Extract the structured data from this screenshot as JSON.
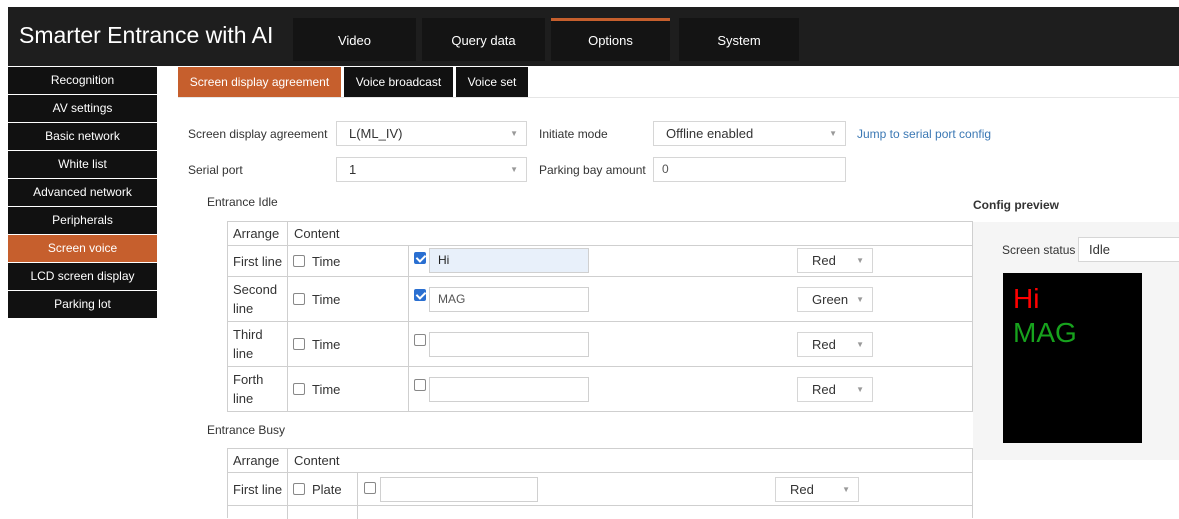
{
  "app": {
    "title": "Smarter Entrance with AI"
  },
  "top_tabs": [
    {
      "label": "Video"
    },
    {
      "label": "Query data"
    },
    {
      "label": "Options"
    },
    {
      "label": "System"
    }
  ],
  "sidebar": {
    "items": [
      {
        "label": "Recognition"
      },
      {
        "label": "AV settings"
      },
      {
        "label": "Basic network"
      },
      {
        "label": "White list"
      },
      {
        "label": "Advanced network"
      },
      {
        "label": "Peripherals"
      },
      {
        "label": "Screen voice"
      },
      {
        "label": "LCD screen display"
      },
      {
        "label": "Parking lot"
      }
    ],
    "active": "Screen voice"
  },
  "sub_tabs": [
    {
      "label": "Screen display agreement"
    },
    {
      "label": "Voice broadcast"
    },
    {
      "label": "Voice set"
    }
  ],
  "form": {
    "agreement_label": "Screen display agreement",
    "agreement_value": "L(ML_IV)",
    "initiate_label": "Initiate mode",
    "initiate_value": "Offline enabled",
    "jump_link": "Jump to serial port config",
    "serial_label": "Serial port",
    "serial_value": "1",
    "parking_label": "Parking bay amount",
    "parking_value": "0"
  },
  "entrance_idle": {
    "title": "Entrance Idle",
    "headers": {
      "arrange": "Arrange",
      "content": "Content"
    },
    "time_label": "Time",
    "rows": [
      {
        "name": "First line",
        "time_checked": false,
        "text_checked": true,
        "text": "Hi",
        "color": "Red"
      },
      {
        "name_a": "Second",
        "name_b": "line",
        "time_checked": false,
        "text_checked": true,
        "text": "MAG",
        "color": "Green"
      },
      {
        "name_a": "Third",
        "name_b": "line",
        "time_checked": false,
        "text_checked": false,
        "text": "",
        "color": "Red"
      },
      {
        "name_a": "Forth",
        "name_b": "line",
        "time_checked": false,
        "text_checked": false,
        "text": "",
        "color": "Red"
      }
    ]
  },
  "entrance_busy": {
    "title": "Entrance Busy",
    "headers": {
      "arrange": "Arrange",
      "content": "Content"
    },
    "plate_label": "Plate",
    "rows": [
      {
        "name": "First line",
        "plate_checked": false,
        "text_checked": false,
        "text": "",
        "color": "Red"
      }
    ]
  },
  "preview": {
    "title": "Config preview",
    "status_label": "Screen status",
    "status_value": "Idle",
    "lines": [
      {
        "text": "Hi",
        "color": "#ff0000"
      },
      {
        "text": "MAG",
        "color": "#17a21d"
      }
    ]
  },
  "colors": {
    "accent": "#c65f2d",
    "header_bg": "#1e1e1e",
    "link": "#3b78b4"
  }
}
